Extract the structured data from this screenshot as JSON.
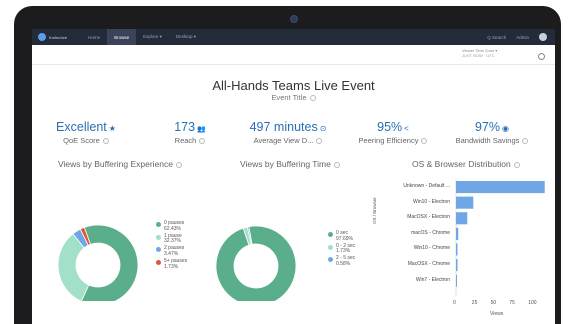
{
  "nav": {
    "brand": "Kollective",
    "items": [
      {
        "label": "Home",
        "active": false
      },
      {
        "label": "Browse",
        "active": true
      },
      {
        "label": "Explore ▾",
        "active": false
      },
      {
        "label": "Desktop ▾",
        "active": false
      }
    ],
    "search": "Q Search",
    "user": "Admin"
  },
  "timezone": {
    "label": "Viewer Time Zone ▾",
    "value": "JUST NOW · UTC"
  },
  "page": {
    "title": "All-Hands Teams Live Event",
    "subtitle": "Event Title"
  },
  "kpis": [
    {
      "value": "Excellent",
      "icon": "star-icon",
      "glyph": "★",
      "label": "QoE Score"
    },
    {
      "value": "173",
      "icon": "users-icon",
      "glyph": "👥",
      "label": "Reach"
    },
    {
      "value": "497 minutes",
      "icon": "clock-icon",
      "glyph": "⊙",
      "label": "Average View D..."
    },
    {
      "value": "95%",
      "icon": "share-icon",
      "glyph": "<",
      "label": "Peering Efficiency"
    },
    {
      "value": "97%",
      "icon": "gauge-icon",
      "glyph": "◉",
      "label": "Bandwidth Savings"
    }
  ],
  "panels": {
    "experience_title": "Views by Buffering Experience",
    "time_title": "Views by Buffering Time",
    "os_title": "OS & Browser Distribution"
  },
  "chart_data": [
    {
      "type": "pie",
      "title": "Views by Buffering Experience",
      "slices": [
        {
          "label": "0 pauses",
          "value": 62.43,
          "display": "62.43%",
          "color": "#5aae8c"
        },
        {
          "label": "1 pause",
          "value": 32.37,
          "display": "32.37%",
          "color": "#a2e0c8"
        },
        {
          "label": "2 pauses",
          "value": 3.47,
          "display": "3.47%",
          "color": "#6fa6e6"
        },
        {
          "label": "5+ pauses",
          "value": 1.73,
          "display": "1.73%",
          "color": "#e0563c"
        }
      ]
    },
    {
      "type": "pie",
      "title": "Views by Buffering Time",
      "slices": [
        {
          "label": "0 sec",
          "value": 97.69,
          "display": "97.69%",
          "color": "#5aae8c"
        },
        {
          "label": "0 - 2 sec",
          "value": 1.73,
          "display": "1.73%",
          "color": "#a2e0c8"
        },
        {
          "label": "2 - 5 sec",
          "value": 0.58,
          "display": "0.58%",
          "color": "#6fa6e6"
        }
      ]
    },
    {
      "type": "bar",
      "orientation": "horizontal",
      "title": "OS & Browser Distribution",
      "categories": [
        "Unknown - Default ...",
        "Win10 - Electron",
        "MacOSX - Electron",
        "macOS - Chrome",
        "Win10 - Chrome",
        "MacOSX - Chrome",
        "Win7 - Electron"
      ],
      "values": [
        118,
        23,
        15,
        3,
        2,
        2,
        1
      ],
      "xlabel": "Views",
      "ylabel": "OS / Browser",
      "xlim": [
        0,
        125
      ],
      "xticks": [
        0,
        25,
        50,
        75,
        100
      ],
      "bar_color": "#6fa6e6"
    }
  ]
}
